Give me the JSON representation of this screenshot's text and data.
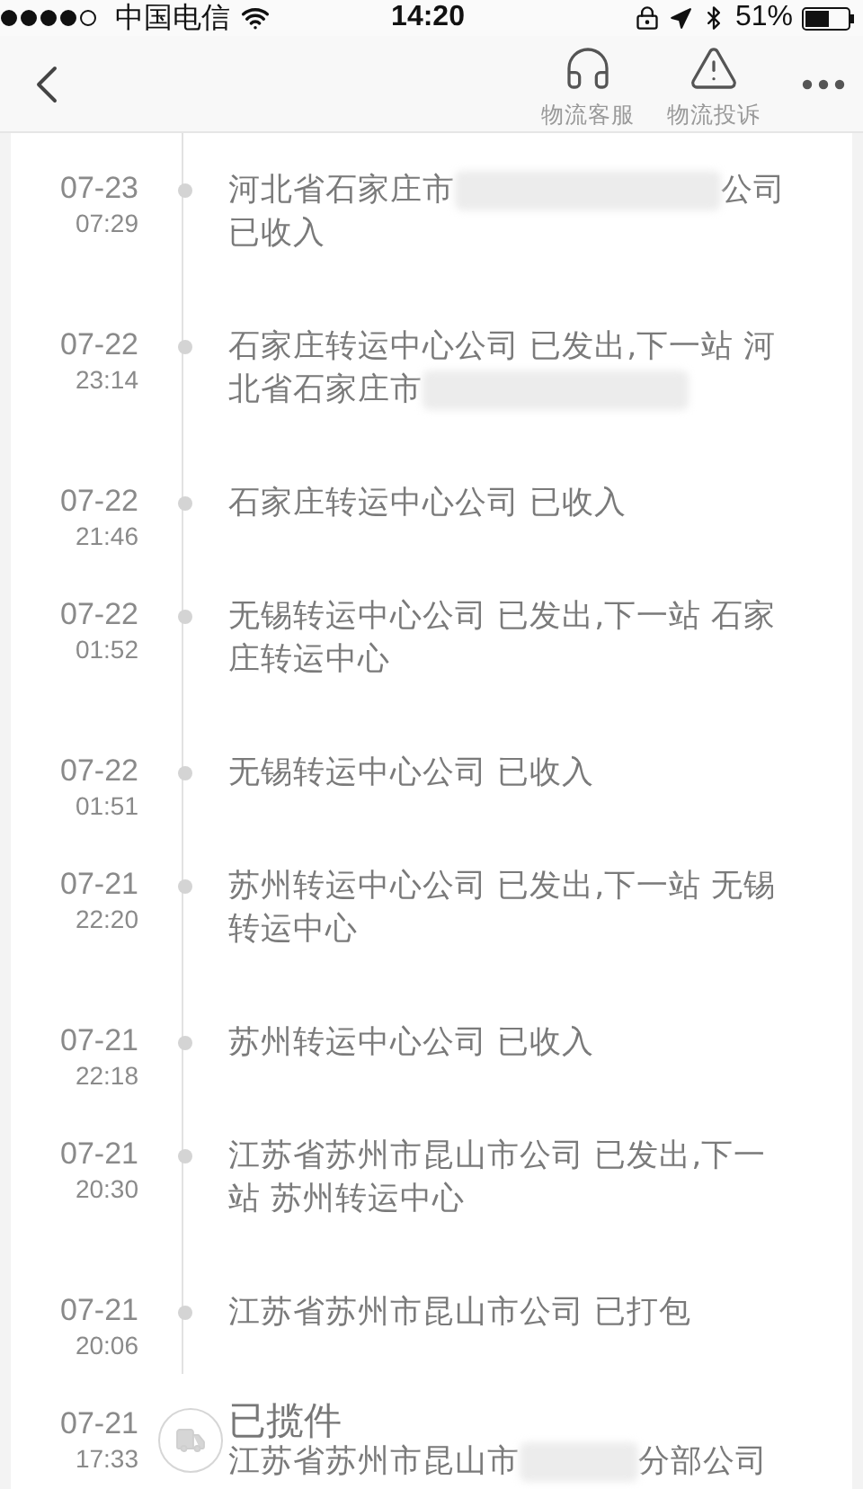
{
  "status_bar": {
    "carrier": "中国电信",
    "time": "14:20",
    "battery": "51%"
  },
  "nav": {
    "actions": [
      {
        "kind": "service",
        "label": "物流客服"
      },
      {
        "kind": "complaint",
        "label": "物流投诉"
      }
    ]
  },
  "events": [
    {
      "date": "07-23",
      "time": "07:29",
      "kind": "normal",
      "parts": [
        {
          "text": "河北省石家庄市"
        },
        {
          "kind": "redacted"
        },
        {
          "text": "公司已收入"
        }
      ]
    },
    {
      "date": "07-22",
      "time": "23:14",
      "kind": "normal",
      "parts": [
        {
          "text": "石家庄转运中心公司 已发出,下一站 河北省石家庄市"
        },
        {
          "kind": "redacted"
        }
      ]
    },
    {
      "date": "07-22",
      "time": "21:46",
      "kind": "normal",
      "parts": [
        {
          "text": "石家庄转运中心公司 已收入"
        }
      ]
    },
    {
      "date": "07-22",
      "time": "01:52",
      "kind": "normal",
      "parts": [
        {
          "text": "无锡转运中心公司 已发出,下一站 石家庄转运中心"
        }
      ]
    },
    {
      "date": "07-22",
      "time": "01:51",
      "kind": "normal",
      "parts": [
        {
          "text": "无锡转运中心公司 已收入"
        }
      ]
    },
    {
      "date": "07-21",
      "time": "22:20",
      "kind": "normal",
      "parts": [
        {
          "text": "苏州转运中心公司 已发出,下一站 无锡转运中心"
        }
      ]
    },
    {
      "date": "07-21",
      "time": "22:18",
      "kind": "normal",
      "parts": [
        {
          "text": "苏州转运中心公司 已收入"
        }
      ]
    },
    {
      "date": "07-21",
      "time": "20:30",
      "kind": "normal",
      "parts": [
        {
          "text": "江苏省苏州市昆山市公司 已发出,下一站 苏州转运中心"
        }
      ]
    },
    {
      "date": "07-21",
      "time": "20:06",
      "kind": "normal",
      "parts": [
        {
          "text": "江苏省苏州市昆山市公司 已打包"
        }
      ]
    },
    {
      "date": "07-21",
      "time": "17:33",
      "kind": "milestone",
      "title": "已揽件",
      "parts": [
        {
          "text": "江苏省苏州市昆山市"
        },
        {
          "kind": "redacted"
        },
        {
          "text": "分部公司"
        }
      ]
    }
  ]
}
